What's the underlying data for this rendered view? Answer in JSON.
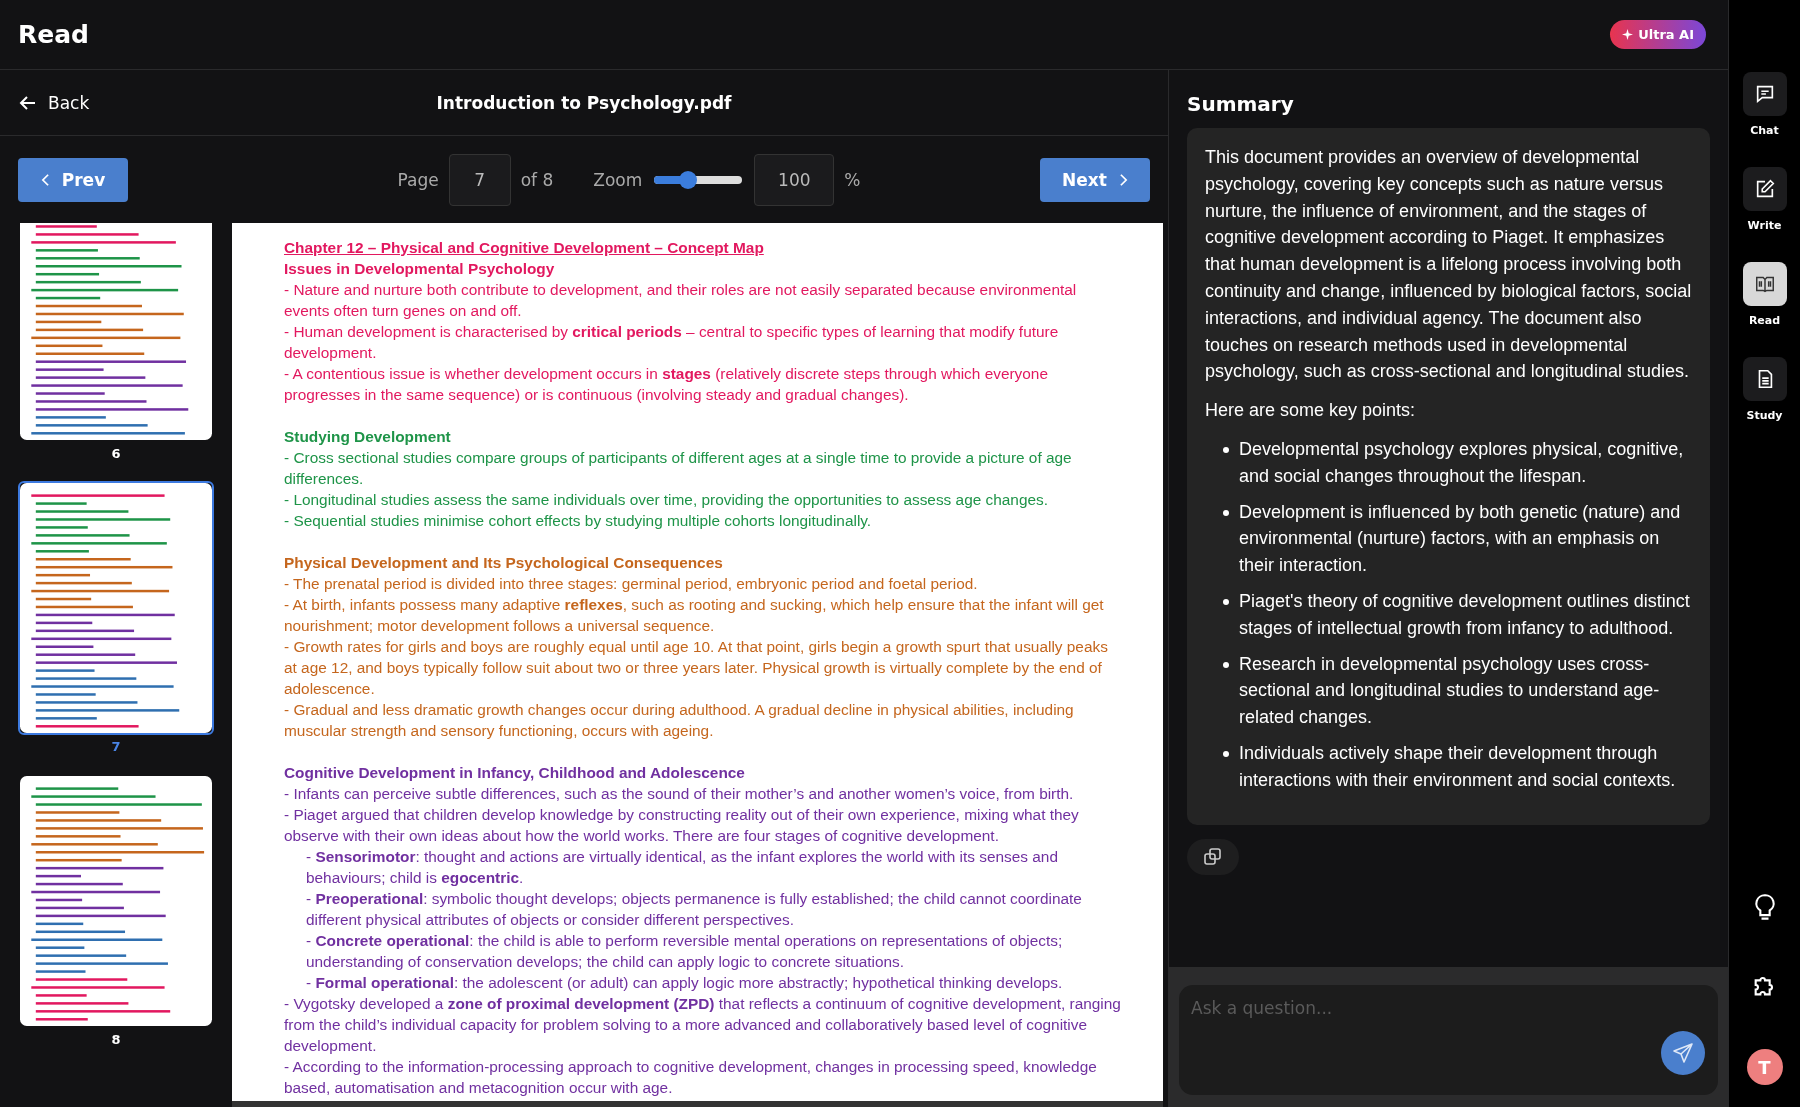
{
  "app": {
    "title": "Read",
    "badge": "Ultra AI"
  },
  "viewer": {
    "back": "Back",
    "file_title": "Introduction to Psychology.pdf",
    "prev": "Prev",
    "next": "Next",
    "page_label": "Page",
    "page_value": "7",
    "page_total": "of 8",
    "zoom_label": "Zoom",
    "zoom": {
      "level": 0.38
    },
    "zoom_value": "100",
    "zoom_unit": "%"
  },
  "thumbnails": [
    {
      "page": "6",
      "selected": false
    },
    {
      "page": "7",
      "selected": true
    },
    {
      "page": "8",
      "selected": false
    }
  ],
  "document": {
    "chapter_title": "Chapter 12 – Physical and Cognitive Development – Concept Map",
    "sections": [
      {
        "heading": "Issues in Developmental Psychology",
        "color": "#e2185f",
        "items": [
          {
            "text": "- Nature and nurture both contribute to development, and their roles are not easily separated because environmental events often turn genes on and off."
          },
          {
            "text": "- Human development is characterised by **critical periods** – central to specific types of learning that modify future development."
          },
          {
            "text": "- A contentious issue is whether development occurs in **stages** (relatively discrete steps through which everyone progresses in the same sequence) or is continuous (involving steady and gradual changes)."
          }
        ]
      },
      {
        "heading": "Studying Development",
        "color": "#1e9448",
        "items": [
          {
            "text": "- Cross sectional studies compare groups of participants of different ages at a single time to provide a picture of age differences."
          },
          {
            "text": "- Longitudinal studies assess the same individuals over time, providing the opportunities to assess age changes."
          },
          {
            "text": "- Sequential studies minimise cohort effects by studying multiple cohorts longitudinally."
          }
        ]
      },
      {
        "heading": "Physical Development and Its Psychological Consequences",
        "color": "#c5661d",
        "items": [
          {
            "text": "- The prenatal period is divided into three stages: germinal period, embryonic period and foetal period."
          },
          {
            "text": "- At birth, infants possess many adaptive **reflexes**, such as rooting and sucking, which help ensure that the infant will get nourishment; motor development follows a universal sequence."
          },
          {
            "text": "- Growth rates for girls and boys are roughly equal until age 10. At that point, girls begin a growth spurt that usually peaks at age 12, and boys typically follow suit about two or three years later. Physical growth is virtually complete by the end of adolescence."
          },
          {
            "text": "- Gradual and less dramatic growth changes occur during adulthood. A gradual decline in physical abilities, including muscular strength and sensory functioning, occurs with ageing."
          }
        ]
      },
      {
        "heading": "Cognitive Development in Infancy, Childhood and Adolescence",
        "color": "#7030a0",
        "items": [
          {
            "text": "- Infants can perceive subtle differences, such as the sound of their mother’s and another women’s voice, from birth."
          },
          {
            "text": "- Piaget argued that children develop knowledge by constructing reality out of their own experience, mixing what they observe with their own ideas about how the world works. There are four stages of cognitive development.",
            "children": [
              {
                "text": "- **Sensorimotor**: thought and actions are virtually identical, as the infant explores the world with its senses and behaviours; child is **egocentric**."
              },
              {
                "text": "- **Preoperational**: symbolic thought develops; objects permanence is fully established; the child cannot coordinate different physical attributes of objects or consider different perspectives."
              },
              {
                "text": "- **Concrete operational**: the child is able to perform reversible mental operations on representations of objects; understanding of conservation develops; the child can apply logic to concrete situations."
              },
              {
                "text": "- **Formal operational**: the adolescent (or adult) can apply logic more abstractly; hypothetical thinking develops."
              }
            ]
          },
          {
            "text": "- Vygotsky developed a **zone of proximal development (ZPD)** that reflects a continuum of cognitive development, ranging from the child’s individual capacity for problem solving to a more advanced and collaboratively based level of cognitive development."
          },
          {
            "text": "- According to the information-processing approach to cognitive development, changes in processing speed, knowledge based, automatisation and metacognition occur with age."
          }
        ]
      }
    ]
  },
  "summary": {
    "title": "Summary",
    "intro": "This document provides an overview of developmental psychology, covering key concepts such as nature versus nurture, the influence of environment, and the stages of cognitive development according to Piaget. It emphasizes that human development is a lifelong process involving both continuity and change, influenced by biological factors, social interactions, and individual agency. The document also touches on research methods used in developmental psychology, such as cross-sectional and longitudinal studies.",
    "lead": "Here are some key points:",
    "points": [
      "Developmental psychology explores physical, cognitive, and social changes throughout the lifespan.",
      "Development is influenced by both genetic (nature) and environmental (nurture) factors, with an emphasis on their interaction.",
      "Piaget's theory of cognitive development outlines distinct stages of intellectual growth from infancy to adulthood.",
      "Research in developmental psychology uses cross-sectional and longitudinal studies to understand age-related changes.",
      "Individuals actively shape their development through interactions with their environment and social contexts."
    ],
    "question": {
      "placeholder": "Ask a question..."
    }
  },
  "rail": {
    "items": [
      {
        "kind": "chat",
        "label": "Chat",
        "selected": false
      },
      {
        "kind": "write",
        "label": "Write",
        "selected": false
      },
      {
        "kind": "read",
        "label": "Read",
        "selected": true
      },
      {
        "kind": "study",
        "label": "Study",
        "selected": false
      }
    ],
    "avatar": "T"
  }
}
